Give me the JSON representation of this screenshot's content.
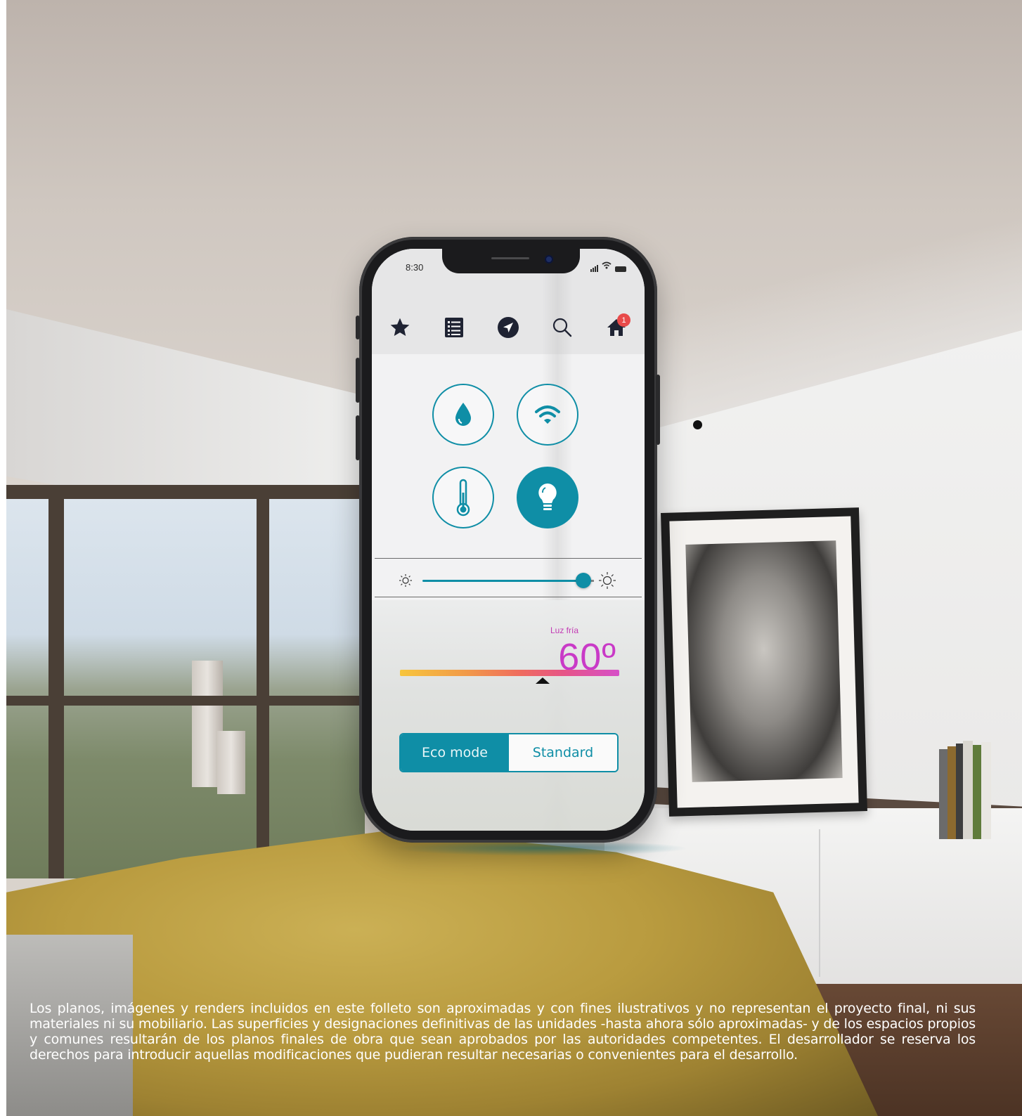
{
  "status_bar": {
    "time": "8:30"
  },
  "nav": {
    "items": [
      {
        "icon": "star-icon"
      },
      {
        "icon": "list-icon"
      },
      {
        "icon": "navigation-arrow-icon"
      },
      {
        "icon": "search-icon"
      },
      {
        "icon": "home-icon",
        "badge": "1"
      }
    ]
  },
  "controls": {
    "tiles": [
      {
        "icon": "water-drop-icon",
        "active": false
      },
      {
        "icon": "wifi-icon",
        "active": false
      },
      {
        "icon": "thermometer-icon",
        "active": false
      },
      {
        "icon": "lightbulb-icon",
        "active": true
      }
    ],
    "brightness": {
      "level": 0.94,
      "min_icon": "sun-small-icon",
      "max_icon": "sun-large-icon"
    }
  },
  "light": {
    "label": "Luz fría",
    "value": "60º",
    "position": 0.65
  },
  "mode": {
    "eco_label": "Eco mode",
    "standard_label": "Standard",
    "selected": "eco"
  },
  "colors": {
    "accent": "#0f8ea6",
    "temperature_text": "#c93ac7",
    "badge": "#e84a4a"
  },
  "disclaimer": "Los planos, imágenes y renders incluidos en este folleto son aproximadas y con fines ilustrativos y no representan el proyecto final, ni sus materiales ni su mobiliario. Las superficies y designaciones definitivas de las unidades -hasta ahora sólo aproximadas- y de los espacios propios y comunes resultarán de los planos finales de obra que sean aprobados por las autoridades competentes. El desarrollador se reserva los derechos para introducir aquellas modificaciones que pudieran resultar necesarias o convenientes para el desarrollo."
}
